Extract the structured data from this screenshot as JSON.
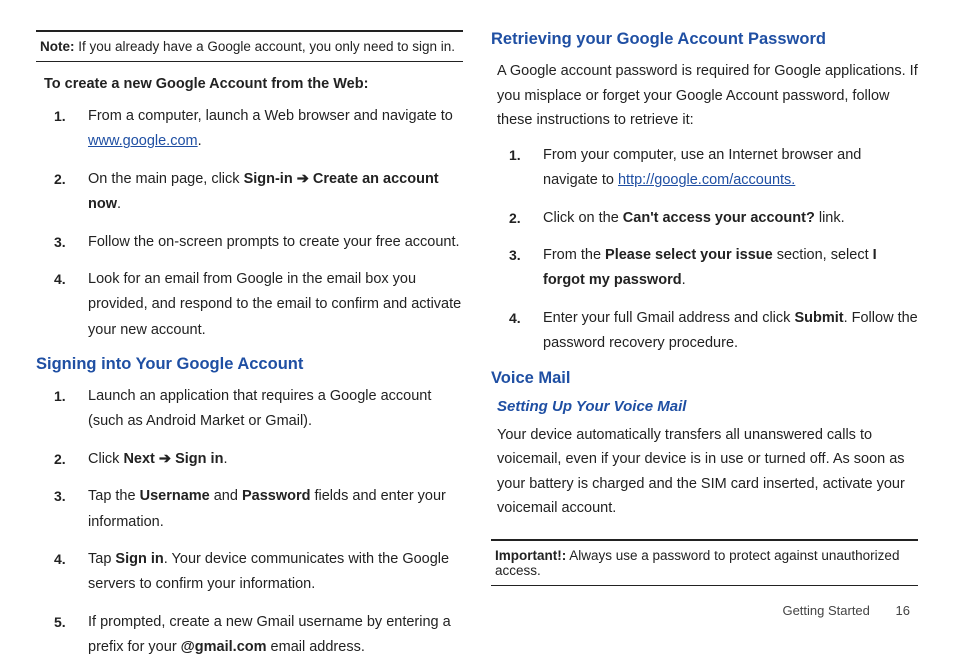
{
  "left": {
    "note_label": "Note:",
    "note_text": " If you already have a Google account, you only need to sign in.",
    "create_heading": "To create a new Google Account from the Web:",
    "create_steps": {
      "s1a": "From a computer, launch a Web browser and navigate to ",
      "s1_link": "www.google.com",
      "s1b": ".",
      "s2a": "On the main page, click ",
      "s2b": "Sign-in ",
      "s2arrow": " ➔ ",
      "s2c": "Create an account now",
      "s2d": ".",
      "s3": "Follow the on-screen prompts to create your free account.",
      "s4": "Look for an email from Google in the email box you provided, and respond to the email to confirm and activate your new account."
    },
    "signin_heading": "Signing into Your Google Account",
    "signin_steps": {
      "s1": "Launch an application that requires a Google account (such as Android Market or Gmail).",
      "s2a": "Click ",
      "s2b": "Next",
      "s2arrow": " ➔ ",
      "s2c": "Sign in",
      "s2d": ".",
      "s3a": "Tap the ",
      "s3b": "Username",
      "s3c": " and ",
      "s3d": "Password",
      "s3e": " fields and enter your information.",
      "s4a": "Tap ",
      "s4b": "Sign in",
      "s4c": ". Your device communicates with the Google servers to confirm your information.",
      "s5a": "If prompted, create a new Gmail username by entering a prefix for your ",
      "s5b": "@gmail.com",
      "s5c": " email address."
    }
  },
  "right": {
    "retrieve_heading": "Retrieving your Google Account Password",
    "retrieve_intro": "A Google account password is required for Google applications. If you misplace or forget your Google Account password, follow these instructions to retrieve it:",
    "retrieve_steps": {
      "s1a": "From your computer, use an Internet browser and navigate to ",
      "s1_link": "http://google.com/accounts.",
      "s2a": "Click on the ",
      "s2b": "Can't access your account?",
      "s2c": " link.",
      "s3a": "From the ",
      "s3b": "Please select your issue",
      "s3c": " section, select ",
      "s3d": "I forgot my password",
      "s3e": ".",
      "s4a": "Enter your full Gmail address and click ",
      "s4b": "Submit",
      "s4c": ". Follow the password recovery procedure."
    },
    "voicemail_heading": "Voice Mail",
    "voicemail_sub": "Setting Up Your Voice Mail",
    "voicemail_body": "Your device automatically transfers all unanswered calls to voicemail, even if your device is in use or turned off. As soon as your battery is charged and the SIM card inserted, activate your voicemail account.",
    "important_label": "Important!:",
    "important_text": " Always use a password to protect against unauthorized access."
  },
  "footer": {
    "section": "Getting Started",
    "page": "16"
  }
}
